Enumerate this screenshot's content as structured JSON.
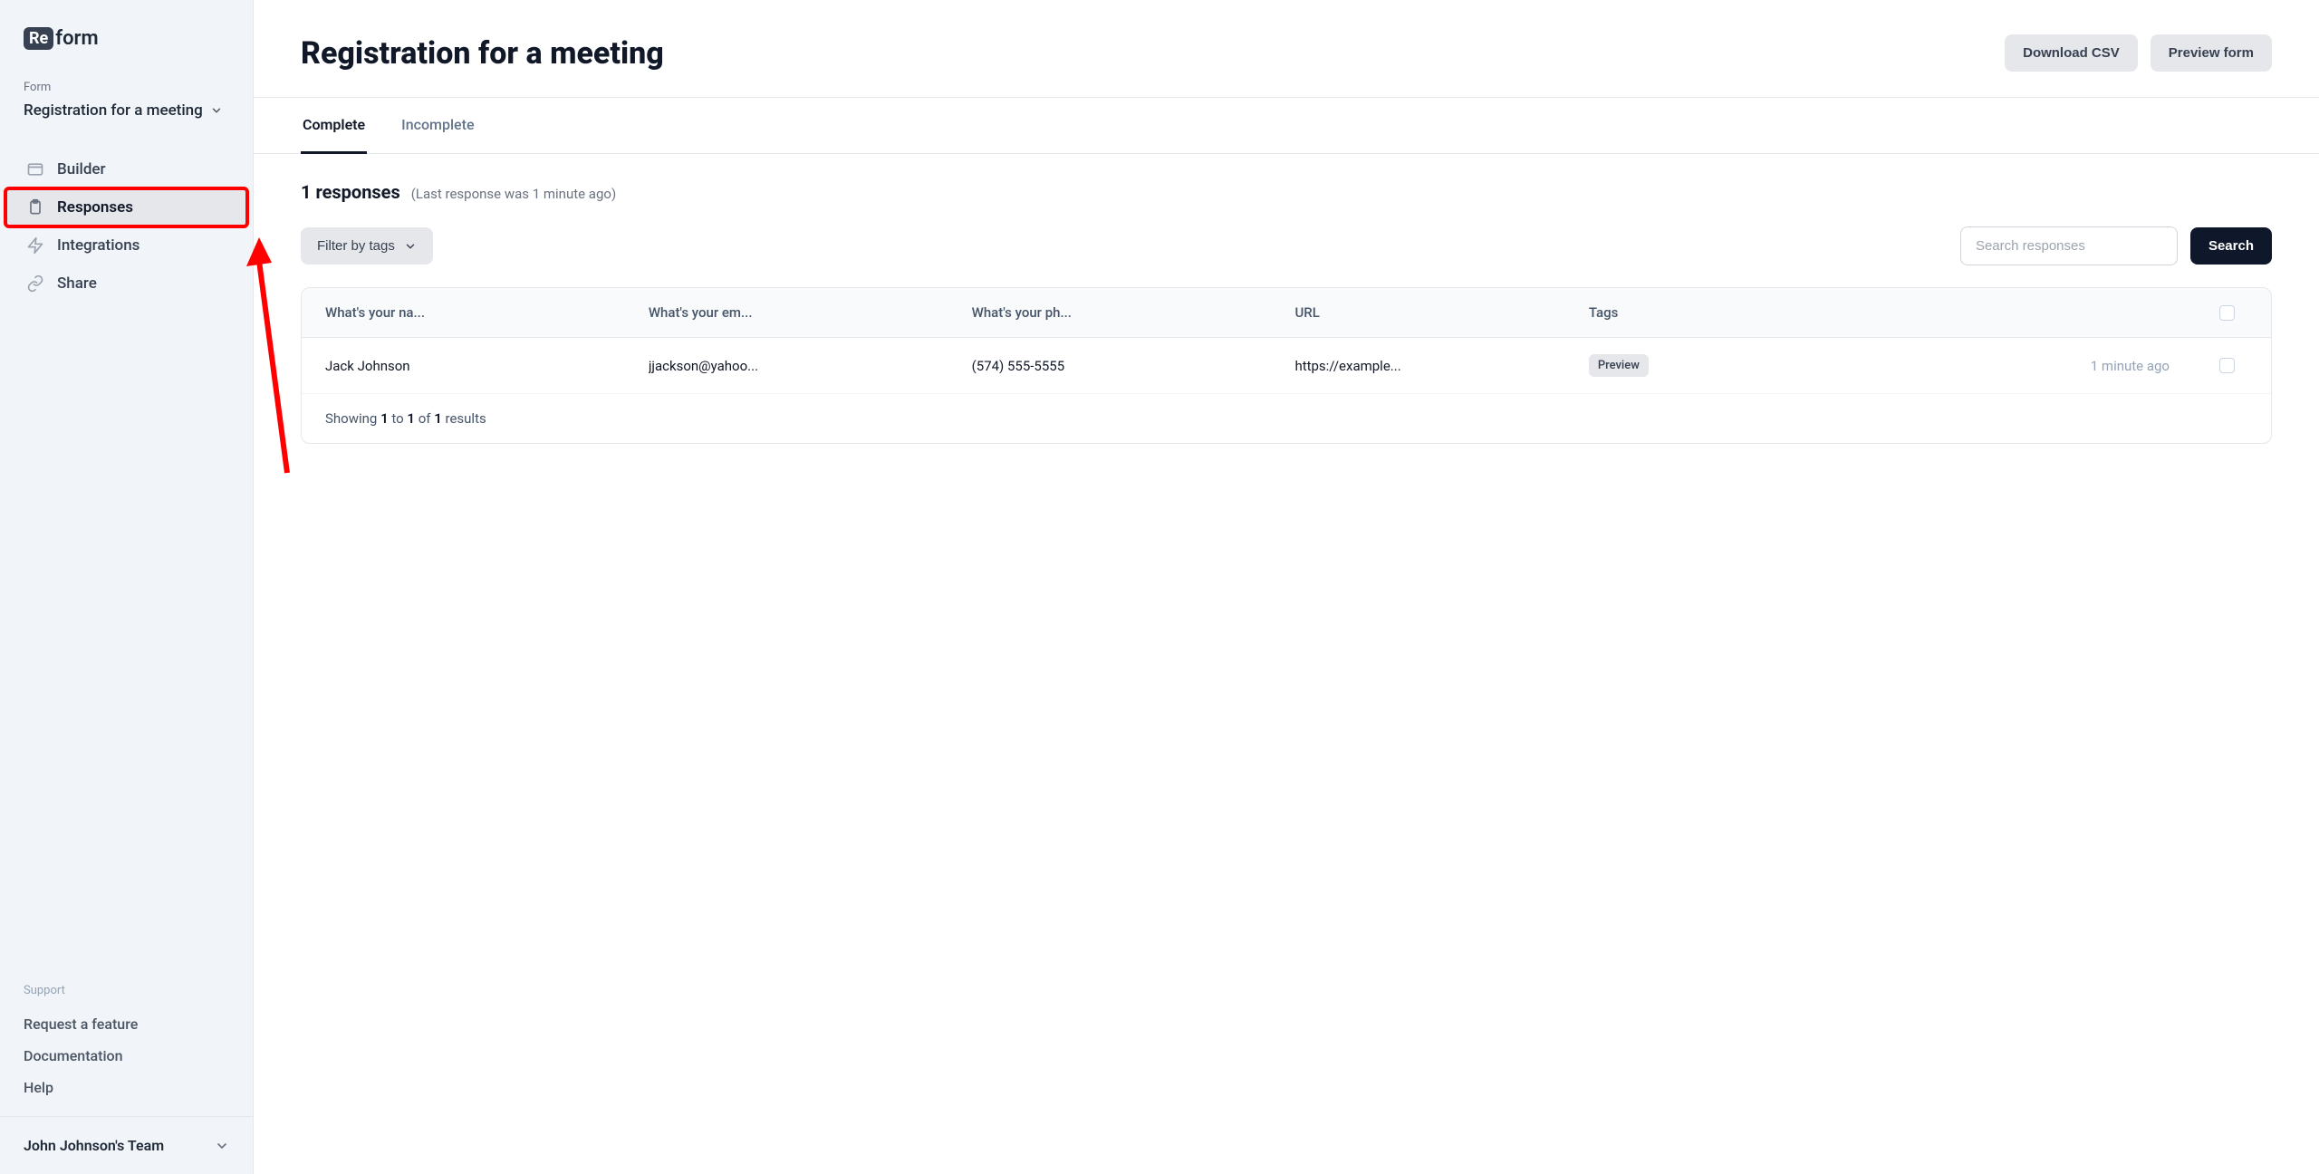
{
  "logo": {
    "badge": "Re",
    "rest": "form"
  },
  "sidebar": {
    "form_label": "Form",
    "form_name": "Registration for a meeting",
    "nav": [
      {
        "icon": "window",
        "label": "Builder"
      },
      {
        "icon": "clipboard",
        "label": "Responses"
      },
      {
        "icon": "bolt",
        "label": "Integrations"
      },
      {
        "icon": "link",
        "label": "Share"
      }
    ],
    "support_label": "Support",
    "support_links": [
      "Request a feature",
      "Documentation",
      "Help"
    ],
    "team": "John Johnson's Team"
  },
  "header": {
    "title": "Registration for a meeting",
    "download_csv": "Download CSV",
    "preview_form": "Preview form"
  },
  "tabs": {
    "complete": "Complete",
    "incomplete": "Incomplete"
  },
  "summary": {
    "count_text": "1 responses",
    "meta_text": "(Last response was 1 minute ago)"
  },
  "toolbar": {
    "filter_label": "Filter by tags",
    "search_placeholder": "Search responses",
    "search_button": "Search"
  },
  "table": {
    "headers": [
      "What's your na...",
      "What's your em...",
      "What's your ph...",
      "URL",
      "Tags",
      ""
    ],
    "rows": [
      {
        "name": "Jack Johnson",
        "email": "jjackson@yahoo...",
        "phone": "(574) 555-5555",
        "url": "https://example...",
        "tag_badge": "Preview",
        "time": "1 minute ago"
      }
    ],
    "footer": {
      "prefix": "Showing ",
      "a": "1",
      "mid1": " to ",
      "b": "1",
      "mid2": " of ",
      "c": "1",
      "suffix": " results"
    }
  }
}
